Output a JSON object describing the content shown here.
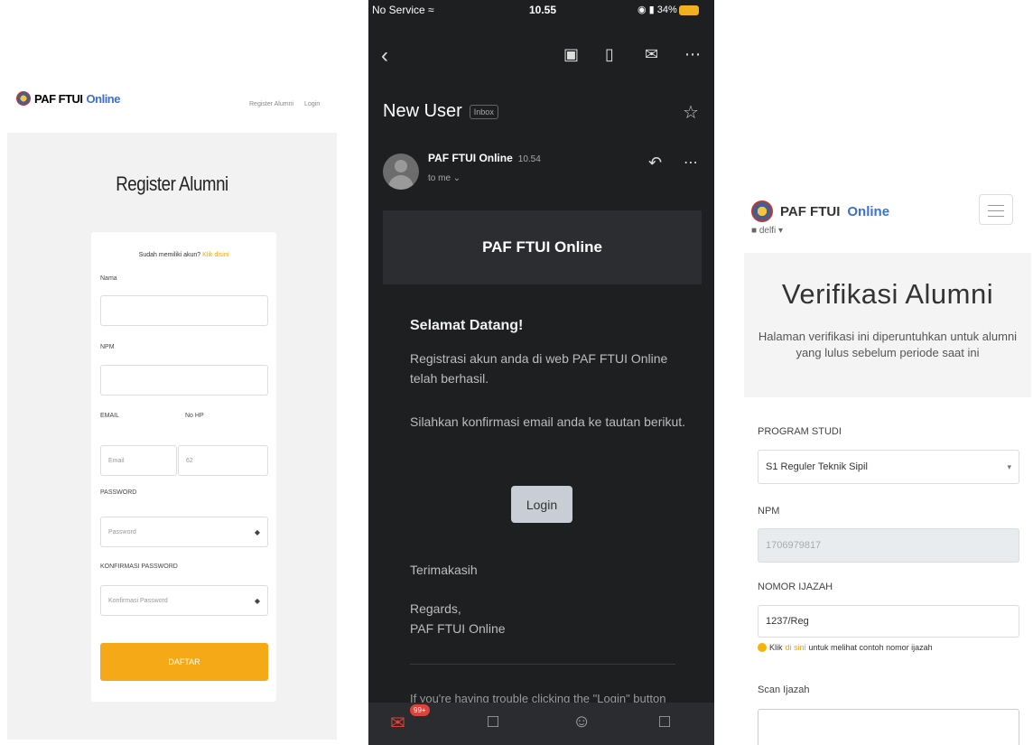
{
  "register": {
    "brand": {
      "name": "PAF FTUI",
      "accent": "Online"
    },
    "nav": {
      "register": "Register Alumni",
      "login": "Login"
    },
    "title": "Register Alumni",
    "have_account": "Sudah memiliki akun?",
    "have_account_link": "Klik disini",
    "fields": {
      "nama_label": "Nama",
      "npm_label": "NPM",
      "email_label": "EMAIL",
      "email_placeholder": "Email",
      "hp_label": "No HP",
      "hp_placeholder": "62",
      "password_label": "PASSWORD",
      "password_placeholder": "Password",
      "confirm_label": "KONFIRMASI PASSWORD",
      "confirm_placeholder": "Konfirmasi Password"
    },
    "submit": "DAFTAR"
  },
  "email": {
    "status": {
      "carrier": "No Service",
      "time": "10.55",
      "battery": "34%"
    },
    "subject": "New User",
    "folder": "Inbox",
    "sender": "PAF FTUI Online",
    "sent_time": "10.54",
    "to": "to me",
    "header_title": "PAF FTUI Online",
    "greeting": "Selamat Datang!",
    "body1": "Registrasi akun anda di web PAF FTUI Online telah berhasil.",
    "body2": "Silahkan konfirmasi email anda ke tautan berikut.",
    "login_button": "Login",
    "thanks": "Terimakasih",
    "regards": "Regards,",
    "signature": "PAF FTUI Online",
    "trouble": "If you're having trouble clicking the \"Login\" button",
    "badge": "99+"
  },
  "verify": {
    "brand": {
      "name": "PAF FTUI",
      "accent": "Online"
    },
    "user": "delfi",
    "title": "Verifikasi Alumni",
    "desc": "Halaman verifikasi ini diperuntuhkan untuk alumni yang lulus sebelum periode saat ini",
    "prodi_label": "PROGRAM STUDI",
    "prodi_value": "S1 Reguler Teknik Sipil",
    "npm_label": "NPM",
    "npm_value": "1706979817",
    "ijazah_label": "NOMOR IJAZAH",
    "ijazah_value": "1237/Reg",
    "hint_pre": "Klik",
    "hint_link": "di sini",
    "hint_post": "untuk melihat contoh nomor ijazah",
    "scan_label": "Scan Ijazah"
  },
  "icons": {
    "back": "chevron-left-icon",
    "archive": "archive-icon",
    "trash": "trash-icon",
    "mail": "mail-icon",
    "more": "more-icon",
    "star": "star-icon",
    "reply": "reply-icon",
    "eye": "eye-icon",
    "menu": "menu-icon",
    "user": "user-icon",
    "info": "info-icon"
  },
  "colors": {
    "accent_orange": "#f6a917",
    "brand_blue": "#3b6fd8",
    "dark_bg": "#1e1f21"
  }
}
